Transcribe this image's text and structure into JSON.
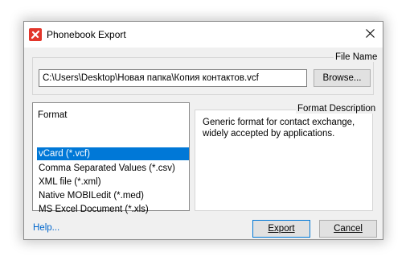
{
  "window": {
    "title": "Phonebook Export",
    "close_icon": "close-icon",
    "app_icon": "mobiledit-app-icon"
  },
  "file_name": {
    "label": "File Name",
    "path": "C:\\Users\\Desktop\\Новая папка\\Копия контактов.vcf",
    "browse_label": "Browse..."
  },
  "format": {
    "header": "Format",
    "items": [
      {
        "label": "vCard (*.vcf)",
        "selected": true
      },
      {
        "label": "Comma Separated Values (*.csv)",
        "selected": false
      },
      {
        "label": "XML file (*.xml)",
        "selected": false
      },
      {
        "label": "Native MOBILedit (*.med)",
        "selected": false
      },
      {
        "label": "MS Excel Document (*.xls)",
        "selected": false
      }
    ]
  },
  "description": {
    "label": "Format Description",
    "text": "Generic format for contact exchange, widely accepted by applications."
  },
  "footer": {
    "help_label": "Help...",
    "export_label": "Export",
    "cancel_label": "Cancel"
  },
  "colors": {
    "selection": "#0078d7",
    "link": "#0066cc",
    "app_icon": "#e2352a"
  }
}
